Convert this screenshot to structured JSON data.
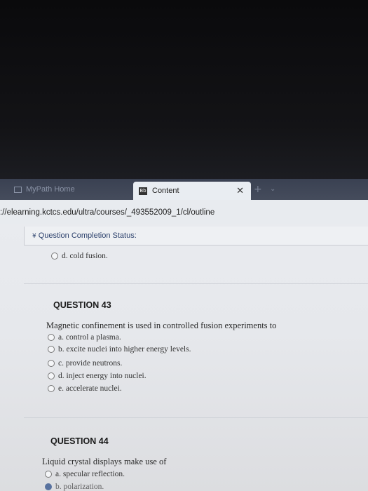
{
  "tabs": [
    {
      "label": "MyPath Home",
      "active": false
    },
    {
      "label": "Content",
      "active": true,
      "icon_text": "Bb"
    }
  ],
  "tab_controls": {
    "close": "✕",
    "new": "+",
    "menu": "⌄"
  },
  "address": {
    "url": "://elearning.kctcs.edu/ultra/courses/_493552009_1/cl/outline"
  },
  "status": {
    "label": "Question Completion Status:"
  },
  "prev_question": {
    "option_d": "d. cold fusion."
  },
  "q43": {
    "heading": "QUESTION 43",
    "prompt": "Magnetic confinement is used in controlled fusion experiments to",
    "options": [
      "a. control a plasma.",
      "b. excite nuclei into higher energy levels.",
      "c. provide neutrons.",
      "d. inject energy into nuclei.",
      "e. accelerate nuclei."
    ]
  },
  "q44": {
    "heading": "QUESTION 44",
    "prompt": "Liquid crystal displays make use of",
    "options": [
      "a. specular reflection.",
      "b. polarization."
    ],
    "selected_index": 1
  },
  "colors": {
    "tabbar": "#3f4657",
    "content_bg": "#e9ebef",
    "accent": "#2d4f8a"
  }
}
